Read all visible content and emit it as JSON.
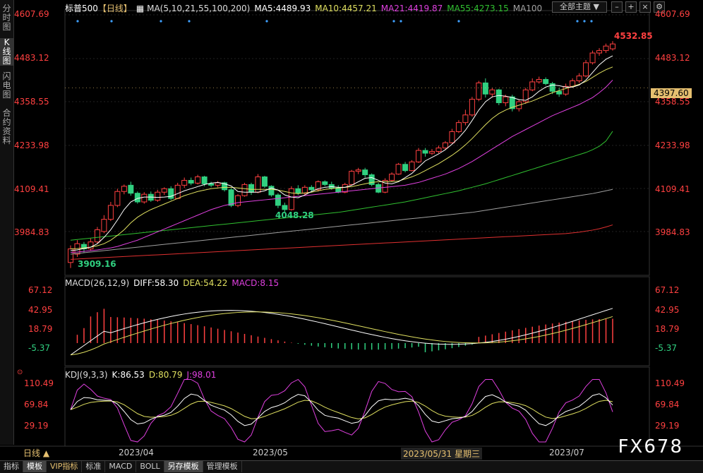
{
  "sidebar": {
    "tabs": [
      "分时图",
      "K线图",
      "闪电图",
      "合约资料"
    ]
  },
  "header": {
    "symbol": "标普500",
    "period": "【日线】",
    "ma_label": "MA(5,10,21,55,100,200)",
    "ma5": "MA5:4489.93",
    "ma10": "MA10:4457.21",
    "ma21": "MA21:4419.87",
    "ma55": "MA55:4273.15",
    "ma100": "MA100",
    "theme": "全部主题"
  },
  "price_axis": [
    "4607.69",
    "4483.12",
    "4358.55",
    "4233.98",
    "4109.41",
    "3984.83"
  ],
  "current_price": "4397.60",
  "annotations": {
    "high": "4532.85",
    "low1": "3909.16",
    "low2": "4048.28"
  },
  "macd": {
    "label": "MACD(26,12,9)",
    "diff": "DIFF:58.30",
    "dea": "DEA:54.22",
    "macd": "MACD:8.15",
    "axis": [
      "67.12",
      "42.95",
      "18.79",
      "-5.37"
    ]
  },
  "kdj": {
    "label": "KDJ(9,3,3)",
    "k": "K:86.53",
    "d": "D:80.79",
    "j": "J:98.01",
    "axis": [
      "110.49",
      "69.84",
      "29.19"
    ]
  },
  "dates": {
    "d1": "2023/04",
    "d2": "2023/05",
    "d3": "2023/05/31 星期三",
    "d4": "2023/07"
  },
  "period_button": "日线 ▲",
  "bottom_tabs": [
    "指标",
    "模板",
    "VIP指标",
    "标准",
    "MACD",
    "BOLL",
    "另存模板",
    "管理模板"
  ],
  "watermark": "FX678",
  "colors": {
    "up": "#ff4040",
    "down": "#30d080",
    "ma5": "#ffffff",
    "ma10": "#e0e060",
    "ma21": "#e040e0",
    "ma55": "#30c030",
    "ma100": "#a0a0a0",
    "ma200": "#e03030"
  },
  "chart_data": {
    "type": "candlestick",
    "candles": [
      [
        3896,
        3935,
        3880,
        3945
      ],
      [
        3920,
        3950,
        3912,
        3960
      ],
      [
        3948,
        3935,
        3925,
        3955
      ],
      [
        3935,
        3955,
        3930,
        3965
      ],
      [
        3955,
        3990,
        3950,
        3998
      ],
      [
        3985,
        4020,
        3980,
        4032
      ],
      [
        4020,
        4060,
        4015,
        4070
      ],
      [
        4060,
        4100,
        4055,
        4108
      ],
      [
        4100,
        4115,
        4092,
        4120
      ],
      [
        4118,
        4095,
        4088,
        4128
      ],
      [
        4095,
        4070,
        4065,
        4100
      ],
      [
        4070,
        4092,
        4065,
        4098
      ],
      [
        4092,
        4075,
        4070,
        4100
      ],
      [
        4075,
        4098,
        4070,
        4105
      ],
      [
        4098,
        4108,
        4090,
        4112
      ],
      [
        4108,
        4080,
        4075,
        4115
      ],
      [
        4080,
        4118,
        4078,
        4125
      ],
      [
        4118,
        4132,
        4110,
        4140
      ],
      [
        4132,
        4124,
        4118,
        4140
      ],
      [
        4124,
        4142,
        4120,
        4148
      ],
      [
        4142,
        4122,
        4115,
        4145
      ],
      [
        4122,
        4118,
        4112,
        4128
      ],
      [
        4118,
        4125,
        4112,
        4130
      ],
      [
        4125,
        4105,
        4100,
        4128
      ],
      [
        4105,
        4060,
        4055,
        4110
      ],
      [
        4060,
        4088,
        4055,
        4092
      ],
      [
        4088,
        4120,
        4085,
        4125
      ],
      [
        4120,
        4098,
        4090,
        4125
      ],
      [
        4098,
        4142,
        4095,
        4150
      ],
      [
        4142,
        4115,
        4110,
        4145
      ],
      [
        4115,
        4090,
        4085,
        4118
      ],
      [
        4090,
        4060,
        4052,
        4095
      ],
      [
        4060,
        4048,
        4040,
        4068
      ],
      [
        4048,
        4108,
        4045,
        4115
      ],
      [
        4108,
        4095,
        4090,
        4118
      ],
      [
        4095,
        4112,
        4090,
        4118
      ],
      [
        4112,
        4105,
        4100,
        4118
      ],
      [
        4105,
        4128,
        4100,
        4132
      ],
      [
        4128,
        4120,
        4115,
        4132
      ],
      [
        4120,
        4110,
        4105,
        4128
      ],
      [
        4110,
        4098,
        4095,
        4118
      ],
      [
        4098,
        4120,
        4095,
        4125
      ],
      [
        4120,
        4158,
        4118,
        4162
      ],
      [
        4158,
        4162,
        4150,
        4168
      ],
      [
        4162,
        4148,
        4140,
        4168
      ],
      [
        4148,
        4120,
        4115,
        4152
      ],
      [
        4120,
        4098,
        4095,
        4125
      ],
      [
        4098,
        4132,
        4095,
        4138
      ],
      [
        4132,
        4150,
        4128,
        4155
      ],
      [
        4150,
        4178,
        4148,
        4182
      ],
      [
        4178,
        4160,
        4155,
        4185
      ],
      [
        4160,
        4185,
        4158,
        4190
      ],
      [
        4185,
        4218,
        4182,
        4225
      ],
      [
        4218,
        4210,
        4200,
        4225
      ],
      [
        4210,
        4215,
        4205,
        4222
      ],
      [
        4215,
        4225,
        4210,
        4232
      ],
      [
        4225,
        4240,
        4220,
        4245
      ],
      [
        4240,
        4272,
        4238,
        4280
      ],
      [
        4272,
        4298,
        4268,
        4305
      ],
      [
        4298,
        4320,
        4290,
        4335
      ],
      [
        4320,
        4365,
        4315,
        4372
      ],
      [
        4365,
        4412,
        4360,
        4418
      ],
      [
        4412,
        4380,
        4370,
        4425
      ],
      [
        4380,
        4392,
        4370,
        4398
      ],
      [
        4392,
        4355,
        4348,
        4395
      ],
      [
        4355,
        4372,
        4345,
        4378
      ],
      [
        4372,
        4338,
        4330,
        4378
      ],
      [
        4338,
        4358,
        4330,
        4365
      ],
      [
        4358,
        4392,
        4352,
        4398
      ],
      [
        4392,
        4415,
        4388,
        4425
      ],
      [
        4415,
        4422,
        4410,
        4430
      ],
      [
        4422,
        4410,
        4405,
        4428
      ],
      [
        4410,
        4388,
        4380,
        4415
      ],
      [
        4388,
        4380,
        4372,
        4398
      ],
      [
        4380,
        4402,
        4375,
        4410
      ],
      [
        4402,
        4418,
        4398,
        4425
      ],
      [
        4418,
        4432,
        4412,
        4440
      ],
      [
        4432,
        4470,
        4428,
        4478
      ],
      [
        4470,
        4498,
        4465,
        4505
      ],
      [
        4498,
        4505,
        4490,
        4512
      ],
      [
        4505,
        4518,
        4498,
        4525
      ],
      [
        4510,
        4524,
        4505,
        4532
      ]
    ],
    "ma5": [
      3930,
      3932,
      3936,
      3940,
      3950,
      3968,
      3990,
      4018,
      4048,
      4070,
      4080,
      4084,
      4084,
      4083,
      4084,
      4086,
      4094,
      4102,
      4108,
      4114,
      4120,
      4124,
      4126,
      4122,
      4116,
      4100,
      4098,
      4098,
      4098,
      4102,
      4110,
      4104,
      4090,
      4084,
      4082,
      4090,
      4100,
      4108,
      4112,
      4114,
      4112,
      4112,
      4118,
      4128,
      4138,
      4140,
      4132,
      4124,
      4122,
      4128,
      4140,
      4152,
      4170,
      4188,
      4198,
      4208,
      4220,
      4236,
      4254,
      4276,
      4304,
      4334,
      4358,
      4372,
      4376,
      4374,
      4370,
      4364,
      4362,
      4372,
      4388,
      4400,
      4406,
      4404,
      4400,
      4400,
      4406,
      4420,
      4442,
      4464,
      4480,
      4490
    ],
    "ma10": [
      3935,
      3936,
      3938,
      3940,
      3944,
      3950,
      3960,
      3974,
      3990,
      4010,
      4026,
      4038,
      4048,
      4056,
      4064,
      4072,
      4080,
      4088,
      4094,
      4100,
      4104,
      4108,
      4110,
      4112,
      4112,
      4110,
      4108,
      4106,
      4106,
      4106,
      4106,
      4104,
      4100,
      4096,
      4094,
      4096,
      4098,
      4102,
      4106,
      4108,
      4110,
      4112,
      4114,
      4118,
      4122,
      4126,
      4128,
      4128,
      4128,
      4130,
      4136,
      4142,
      4150,
      4160,
      4170,
      4180,
      4192,
      4204,
      4218,
      4234,
      4252,
      4272,
      4292,
      4310,
      4324,
      4334,
      4342,
      4348,
      4354,
      4360,
      4368,
      4376,
      4384,
      4390,
      4396,
      4402,
      4408,
      4416,
      4428,
      4440,
      4450,
      4458
    ],
    "ma21": [
      3925,
      3926,
      3928,
      3930,
      3932,
      3935,
      3938,
      3942,
      3948,
      3954,
      3960,
      3968,
      3976,
      3984,
      3992,
      4000,
      4008,
      4016,
      4024,
      4032,
      4040,
      4048,
      4054,
      4060,
      4064,
      4068,
      4070,
      4072,
      4074,
      4076,
      4078,
      4080,
      4082,
      4084,
      4086,
      4088,
      4090,
      4092,
      4094,
      4096,
      4098,
      4100,
      4102,
      4104,
      4106,
      4108,
      4110,
      4112,
      4114,
      4116,
      4118,
      4122,
      4126,
      4132,
      4138,
      4144,
      4150,
      4158,
      4166,
      4176,
      4186,
      4198,
      4210,
      4222,
      4234,
      4246,
      4258,
      4268,
      4278,
      4288,
      4298,
      4308,
      4318,
      4326,
      4334,
      4342,
      4350,
      4360,
      4370,
      4384,
      4400,
      4420
    ],
    "ma55": [
      3960,
      3962,
      3964,
      3966,
      3968,
      3970,
      3972,
      3974,
      3976,
      3978,
      3980,
      3982,
      3984,
      3986,
      3988,
      3990,
      3992,
      3994,
      3996,
      3998,
      4000,
      4002,
      4004,
      4006,
      4008,
      4010,
      4012,
      4014,
      4016,
      4018,
      4020,
      4022,
      4024,
      4026,
      4028,
      4030,
      4032,
      4034,
      4036,
      4038,
      4040,
      4043,
      4046,
      4049,
      4052,
      4055,
      4058,
      4061,
      4064,
      4067,
      4070,
      4074,
      4078,
      4082,
      4086,
      4090,
      4094,
      4098,
      4102,
      4107,
      4112,
      4117,
      4122,
      4128,
      4134,
      4140,
      4146,
      4152,
      4158,
      4164,
      4170,
      4176,
      4182,
      4188,
      4194,
      4200,
      4206,
      4212,
      4220,
      4230,
      4245,
      4273
    ],
    "ma100": [
      3920,
      3922,
      3924,
      3926,
      3928,
      3930,
      3932,
      3934,
      3936,
      3938,
      3940,
      3942,
      3944,
      3946,
      3948,
      3950,
      3952,
      3954,
      3956,
      3958,
      3960,
      3962,
      3964,
      3966,
      3968,
      3970,
      3972,
      3974,
      3976,
      3978,
      3980,
      3982,
      3984,
      3986,
      3988,
      3990,
      3992,
      3994,
      3996,
      3998,
      4000,
      4002,
      4004,
      4006,
      4008,
      4010,
      4012,
      4014,
      4016,
      4018,
      4020,
      4022,
      4024,
      4026,
      4028,
      4030,
      4032,
      4034,
      4036,
      4038,
      4040,
      4043,
      4046,
      4049,
      4052,
      4055,
      4058,
      4061,
      4064,
      4067,
      4070,
      4073,
      4076,
      4079,
      4082,
      4085,
      4088,
      4091,
      4094,
      4098,
      4102,
      4106
    ],
    "ma200": [
      3905,
      3906,
      3907,
      3908,
      3909,
      3910,
      3911,
      3912,
      3913,
      3914,
      3915,
      3916,
      3917,
      3918,
      3919,
      3920,
      3921,
      3922,
      3923,
      3924,
      3925,
      3926,
      3927,
      3928,
      3929,
      3930,
      3931,
      3932,
      3933,
      3934,
      3935,
      3936,
      3937,
      3938,
      3939,
      3940,
      3941,
      3942,
      3943,
      3944,
      3945,
      3946,
      3947,
      3948,
      3949,
      3950,
      3951,
      3952,
      3953,
      3954,
      3955,
      3956,
      3957,
      3958,
      3959,
      3960,
      3961,
      3962,
      3963,
      3964,
      3965,
      3966,
      3967,
      3968,
      3969,
      3970,
      3971,
      3972,
      3973,
      3974,
      3975,
      3976,
      3977,
      3978,
      3979,
      3981,
      3983,
      3986,
      3989,
      3993,
      3998,
      4004
    ],
    "ylim": [
      3960,
      4617
    ],
    "macd_ylim": [
      -18,
      72
    ],
    "kdj_ylim": [
      -5,
      120
    ]
  }
}
